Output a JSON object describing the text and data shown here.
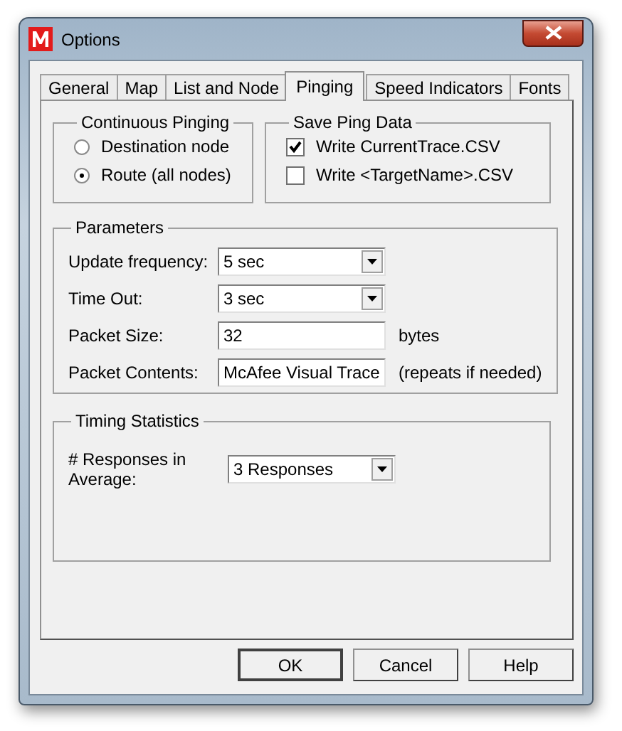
{
  "window": {
    "title": "Options"
  },
  "tabs": [
    {
      "label": "General",
      "selected": false
    },
    {
      "label": "Map",
      "selected": false
    },
    {
      "label": "List and Node",
      "selected": false
    },
    {
      "label": "Pinging",
      "selected": true
    },
    {
      "label": "Speed Indicators",
      "selected": false
    },
    {
      "label": "Fonts",
      "selected": false
    }
  ],
  "continuous_pinging": {
    "title": "Continuous Pinging",
    "options": [
      {
        "label": "Destination node",
        "selected": false
      },
      {
        "label": "Route (all nodes)",
        "selected": true
      }
    ]
  },
  "save_ping_data": {
    "title": "Save Ping Data",
    "options": [
      {
        "label": "Write CurrentTrace.CSV",
        "checked": true
      },
      {
        "label": "Write <TargetName>.CSV",
        "checked": false
      }
    ]
  },
  "parameters": {
    "title": "Parameters",
    "fields": [
      {
        "kind": "select",
        "label": "Update frequency:",
        "value": "5 sec"
      },
      {
        "kind": "select",
        "label": "Time Out:",
        "value": "3 sec"
      },
      {
        "kind": "input",
        "label": "Packet Size:",
        "value": "32",
        "suffix": "bytes"
      },
      {
        "kind": "input",
        "label": "Packet Contents:",
        "value": "McAfee Visual Trace",
        "suffix": "(repeats if needed)"
      }
    ]
  },
  "timing_statistics": {
    "title": "Timing Statistics",
    "fields": [
      {
        "kind": "select",
        "label": "# Responses in Average:",
        "value": "3 Responses"
      }
    ]
  },
  "buttons": [
    {
      "label": "OK",
      "default": true
    },
    {
      "label": "Cancel",
      "default": false
    },
    {
      "label": "Help",
      "default": false
    }
  ]
}
